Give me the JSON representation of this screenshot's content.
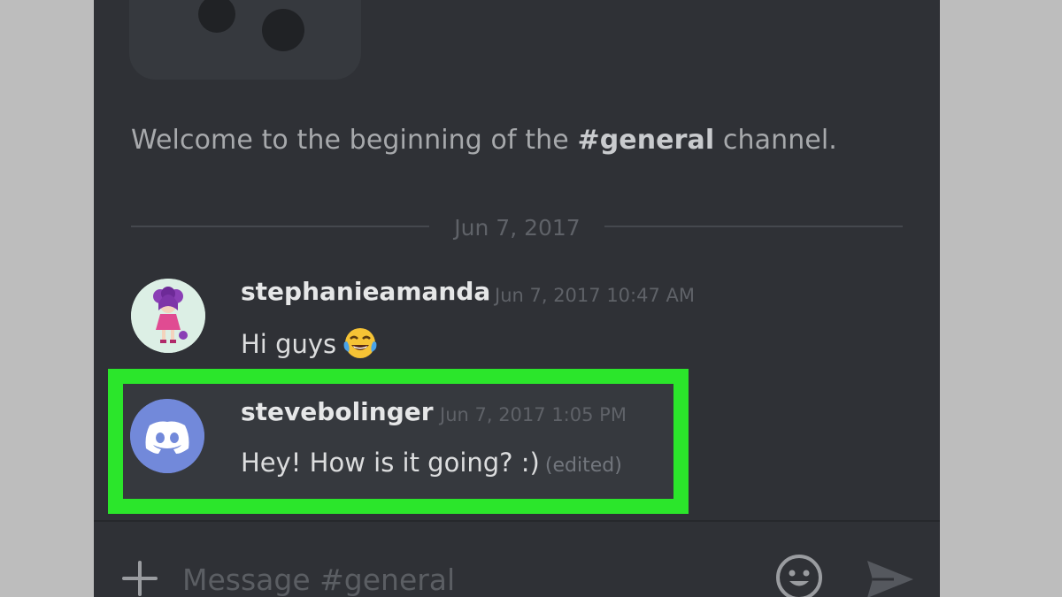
{
  "channel": {
    "welcome_prefix": "Welcome to the beginning of the ",
    "channel_name": "#general",
    "welcome_suffix": " channel."
  },
  "date_divider": "Jun 7, 2017",
  "messages": [
    {
      "username": "stephanieamanda",
      "timestamp": "Jun 7, 2017 10:47 AM",
      "text": "Hi guys",
      "emoji": "face-with-tears-of-joy-icon"
    },
    {
      "username": "stevebolinger",
      "timestamp": "Jun 7, 2017 1:05 PM",
      "text": "Hey! How is it going? :)",
      "edited_label": "(edited)"
    }
  ],
  "composer": {
    "placeholder": "Message #general"
  },
  "colors": {
    "background": "#2f3136",
    "highlight_border": "#2be62b",
    "discord_blurple": "#7289da"
  }
}
